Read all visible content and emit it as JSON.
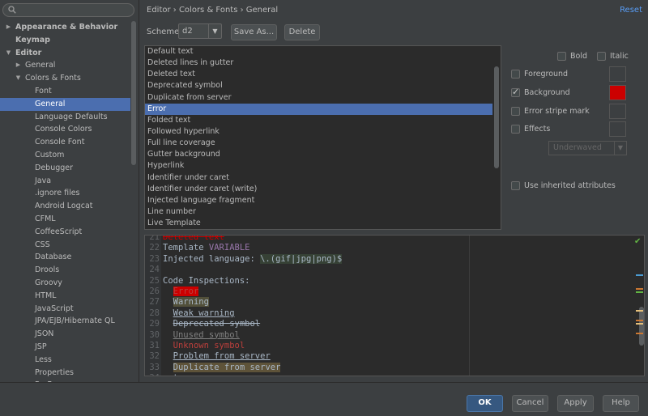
{
  "search": {
    "value": "",
    "icon": "search-icon"
  },
  "tree": [
    {
      "label": "Appearance & Behavior",
      "level": 0,
      "arrow": "right",
      "bold": true
    },
    {
      "label": "Keymap",
      "level": 0,
      "arrow": "",
      "bold": true
    },
    {
      "label": "Editor",
      "level": 0,
      "arrow": "down",
      "bold": true
    },
    {
      "label": "General",
      "level": 1,
      "arrow": "right"
    },
    {
      "label": "Colors & Fonts",
      "level": 1,
      "arrow": "down"
    },
    {
      "label": "Font",
      "level": 2,
      "arrow": ""
    },
    {
      "label": "General",
      "level": 2,
      "arrow": "",
      "selected": true
    },
    {
      "label": "Language Defaults",
      "level": 2,
      "arrow": ""
    },
    {
      "label": "Console Colors",
      "level": 2,
      "arrow": ""
    },
    {
      "label": "Console Font",
      "level": 2,
      "arrow": ""
    },
    {
      "label": "Custom",
      "level": 2,
      "arrow": ""
    },
    {
      "label": "Debugger",
      "level": 2,
      "arrow": ""
    },
    {
      "label": "Java",
      "level": 2,
      "arrow": ""
    },
    {
      "label": ".ignore files",
      "level": 2,
      "arrow": ""
    },
    {
      "label": "Android Logcat",
      "level": 2,
      "arrow": ""
    },
    {
      "label": "CFML",
      "level": 2,
      "arrow": ""
    },
    {
      "label": "CoffeeScript",
      "level": 2,
      "arrow": ""
    },
    {
      "label": "CSS",
      "level": 2,
      "arrow": ""
    },
    {
      "label": "Database",
      "level": 2,
      "arrow": ""
    },
    {
      "label": "Drools",
      "level": 2,
      "arrow": ""
    },
    {
      "label": "Groovy",
      "level": 2,
      "arrow": ""
    },
    {
      "label": "HTML",
      "level": 2,
      "arrow": ""
    },
    {
      "label": "JavaScript",
      "level": 2,
      "arrow": ""
    },
    {
      "label": "JPA/EJB/Hibernate QL",
      "level": 2,
      "arrow": ""
    },
    {
      "label": "JSON",
      "level": 2,
      "arrow": ""
    },
    {
      "label": "JSP",
      "level": 2,
      "arrow": ""
    },
    {
      "label": "Less",
      "level": 2,
      "arrow": ""
    },
    {
      "label": "Properties",
      "level": 2,
      "arrow": ""
    },
    {
      "label": "R...F...",
      "level": 2,
      "arrow": ""
    }
  ],
  "header": {
    "breadcrumb": "Editor › Colors & Fonts › General",
    "reset": "Reset"
  },
  "scheme": {
    "label": "Scheme:",
    "selected": "d2",
    "save_as": "Save As...",
    "delete": "Delete"
  },
  "attributes": [
    "Default text",
    "Deleted lines in gutter",
    "Deleted text",
    "Deprecated symbol",
    "Duplicate from server",
    "Error",
    "Folded text",
    "Followed hyperlink",
    "Full line coverage",
    "Gutter background",
    "Hyperlink",
    "Identifier under caret",
    "Identifier under caret (write)",
    "Injected language fragment",
    "Line number",
    "Live Template"
  ],
  "selected_attribute": "Error",
  "options": {
    "bold": {
      "label": "Bold",
      "checked": false
    },
    "italic": {
      "label": "Italic",
      "checked": false
    },
    "foreground": {
      "label": "Foreground",
      "checked": false,
      "color": ""
    },
    "background": {
      "label": "Background",
      "checked": true,
      "color": "#cc0000"
    },
    "error_stripe": {
      "label": "Error stripe mark",
      "checked": false,
      "color": ""
    },
    "effects": {
      "label": "Effects",
      "checked": false,
      "color": ""
    },
    "effect_type": "Underwaved",
    "inherited": {
      "label": "Use inherited attributes",
      "checked": false
    }
  },
  "preview": {
    "lines": [
      {
        "n": "21",
        "segments": [
          {
            "t": "Deleted text",
            "c": "#cc0000",
            "strike": true
          }
        ]
      },
      {
        "n": "22",
        "segments": [
          {
            "t": "Template ",
            "c": "#a9b7c6"
          },
          {
            "t": "VARIABLE",
            "c": "#9876aa"
          }
        ]
      },
      {
        "n": "23",
        "segments": [
          {
            "t": "Injected language: ",
            "c": "#a9b7c6"
          },
          {
            "t": "\\.(gif|jpg|png)$",
            "c": "#a9b7c6",
            "bg": "#364135"
          }
        ]
      },
      {
        "n": "24",
        "segments": []
      },
      {
        "n": "25",
        "segments": [
          {
            "t": "Code Inspections:",
            "c": "#a9b7c6"
          }
        ]
      },
      {
        "n": "26",
        "segments": [
          {
            "t": "  "
          },
          {
            "t": "Error",
            "c": "#bc3f3c",
            "bg": "#cc0000"
          }
        ]
      },
      {
        "n": "27",
        "segments": [
          {
            "t": "  "
          },
          {
            "t": "Warning",
            "c": "#a9b7c6",
            "bg": "#52503a"
          }
        ]
      },
      {
        "n": "28",
        "segments": [
          {
            "t": "  "
          },
          {
            "t": "Weak warning",
            "c": "#a9b7c6",
            "underline": true
          }
        ]
      },
      {
        "n": "29",
        "segments": [
          {
            "t": "  "
          },
          {
            "t": "Deprecated symbol",
            "c": "#a9b7c6",
            "strike": true
          }
        ]
      },
      {
        "n": "30",
        "segments": [
          {
            "t": "  "
          },
          {
            "t": "Unused symbol",
            "c": "#808080",
            "underline": true
          }
        ]
      },
      {
        "n": "31",
        "segments": [
          {
            "t": "  "
          },
          {
            "t": "Unknown symbol",
            "c": "#bc3f3c"
          }
        ]
      },
      {
        "n": "32",
        "segments": [
          {
            "t": "  "
          },
          {
            "t": "Problem from server",
            "c": "#a9b7c6",
            "underline": true
          }
        ]
      },
      {
        "n": "33",
        "segments": [
          {
            "t": "  "
          },
          {
            "t": "Duplicate from server",
            "c": "#a9b7c6",
            "bg": "#5e5339"
          }
        ]
      },
      {
        "n": "34",
        "segments": [
          {
            "t": "  typo",
            "c": "#a9b7c6"
          }
        ]
      }
    ],
    "marker_colors": [
      "#4b9cd3",
      "#cc7832",
      "#62b543",
      "#e6c07b",
      "#cc7832",
      "#e6c07b",
      "#cc7832"
    ],
    "status_icon": "check-icon"
  },
  "footer": {
    "ok": "OK",
    "cancel": "Cancel",
    "apply": "Apply",
    "help": "Help"
  }
}
